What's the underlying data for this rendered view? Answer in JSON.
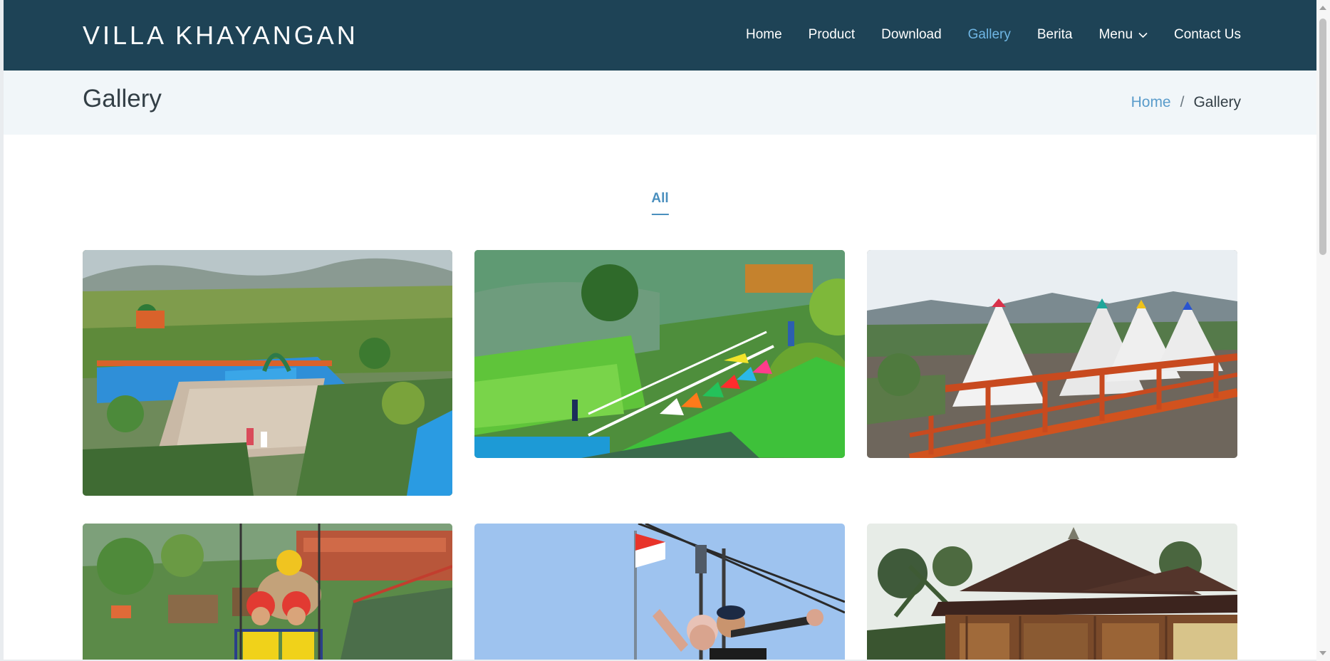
{
  "header": {
    "logo": "VILLA KHAYANGAN",
    "nav": [
      {
        "label": "Home",
        "active": false
      },
      {
        "label": "Product",
        "active": false
      },
      {
        "label": "Download",
        "active": false
      },
      {
        "label": "Gallery",
        "active": true
      },
      {
        "label": "Berita",
        "active": false
      },
      {
        "label": "Menu",
        "active": false,
        "dropdown": true
      },
      {
        "label": "Contact Us",
        "active": false
      }
    ],
    "colors": {
      "background": "#1e4356",
      "active": "#6fb6e4",
      "text": "#ffffff"
    }
  },
  "breadcrumbs": {
    "title": "Gallery",
    "items": [
      "Home",
      "Gallery"
    ],
    "separator": "/"
  },
  "filter": {
    "items": [
      "All"
    ],
    "active": "All",
    "accent": "#4a8fbe"
  },
  "gallery": {
    "photos": [
      {
        "name": "water-park-overview-photo"
      },
      {
        "name": "colorful-cushion-terrace-photo"
      },
      {
        "name": "teepee-tents-photo"
      },
      {
        "name": "sky-bike-riders-photo"
      },
      {
        "name": "zipline-couple-photo"
      },
      {
        "name": "joglo-wooden-house-photo"
      }
    ]
  }
}
